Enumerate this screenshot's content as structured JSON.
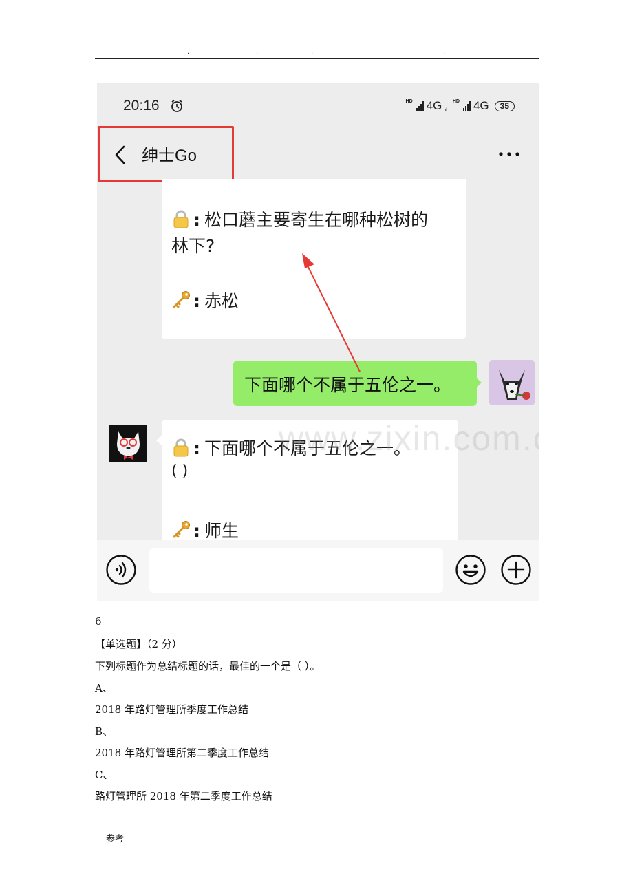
{
  "page_header": {
    "dots": [
      ".",
      ".",
      ".",
      "."
    ]
  },
  "screenshot": {
    "status_bar": {
      "time": "20:16",
      "hd_label": "HD",
      "network_1": "4G",
      "network_1_suffix": "ıl",
      "network_2": "4G",
      "battery": "35"
    },
    "nav": {
      "title": "绅士Go",
      "icons": {
        "back": "chevron-left-icon",
        "more": "more-horizontal-icon"
      }
    },
    "messages": [
      {
        "from": "bot",
        "question_label": "松口蘑主要寄生在哪种松树的",
        "question_label_2": "林下?",
        "answer": "赤松",
        "icons": [
          "lock-icon",
          "key-icon"
        ]
      },
      {
        "from": "user",
        "text": "下面哪个不属于五伦之一。"
      },
      {
        "from": "bot",
        "question_label": "下面哪个不属于五伦之一。",
        "question_label_2": "( )",
        "answer": "师生",
        "icons": [
          "lock-icon",
          "key-icon"
        ]
      }
    ],
    "watermark": "www.zixin.com.cn",
    "input_bar": {
      "placeholder": "",
      "icons": [
        "voice-icon",
        "emoji-icon",
        "plus-icon"
      ]
    },
    "colors": {
      "annotation": "#e53935",
      "user_bubble": "#95ec69",
      "chat_bg": "#ededed"
    }
  },
  "document": {
    "question_number": "6",
    "question_type": "【单选题】（2 分）",
    "question_text": "下列标题作为总结标题的话，最佳的一个是（     ）。",
    "options": [
      {
        "label": "A、",
        "text": "2018 年路灯管理所季度工作总结"
      },
      {
        "label": "B、",
        "text": "2018 年路灯管理所第二季度工作总结"
      },
      {
        "label": "C、",
        "text": "路灯管理所 2018 年第二季度工作总结"
      }
    ],
    "footer": "参考"
  }
}
